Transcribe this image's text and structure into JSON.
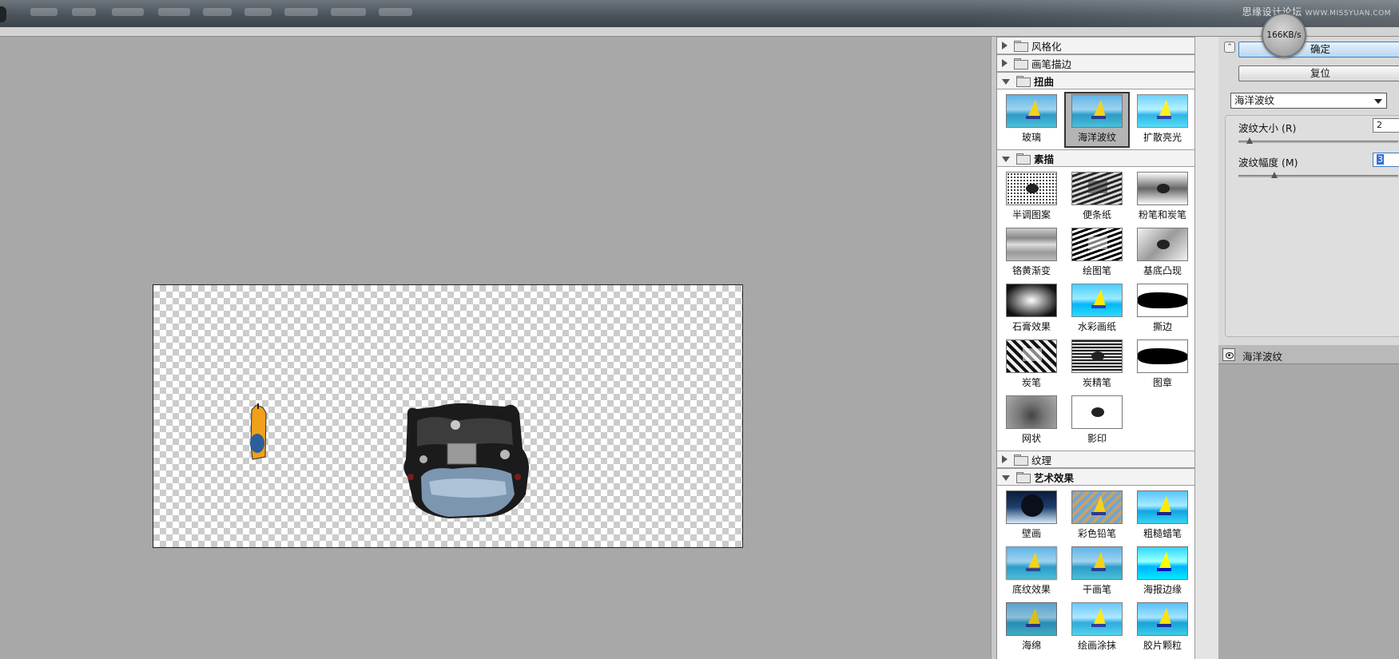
{
  "titlebar": {
    "watermark": "思缘设计论坛",
    "watermark_url": "WWW.MISSYUAN.COM"
  },
  "speed_indicator": "166KB/s",
  "gallery": {
    "categories": [
      {
        "label": "风格化",
        "open": false
      },
      {
        "label": "画笔描边",
        "open": false
      },
      {
        "label": "扭曲",
        "open": true,
        "items": [
          "玻璃",
          "海洋波纹",
          "扩散亮光"
        ]
      },
      {
        "label": "素描",
        "open": true,
        "items": [
          "半调图案",
          "便条纸",
          "粉笔和炭笔",
          "铬黄渐变",
          "绘图笔",
          "基底凸现",
          "石膏效果",
          "水彩画纸",
          "撕边",
          "炭笔",
          "炭精笔",
          "图章",
          "网状",
          "影印"
        ]
      },
      {
        "label": "纹理",
        "open": false
      },
      {
        "label": "艺术效果",
        "open": true,
        "items": [
          "壁画",
          "彩色铅笔",
          "粗糙蜡笔",
          "底纹效果",
          "干画笔",
          "海报边缘",
          "海绵",
          "绘画涂抹",
          "胶片颗粒"
        ]
      }
    ],
    "selected": "海洋波纹"
  },
  "controls": {
    "ok_label": "确定",
    "reset_label": "复位",
    "filter_select": "海洋波纹",
    "ripple_size_label": "波纹大小 (R)",
    "ripple_size_value": "2",
    "ripple_magnitude_label": "波纹幅度 (M)",
    "ripple_magnitude_value": "3"
  },
  "layers": {
    "active_layer": "海洋波纹"
  }
}
